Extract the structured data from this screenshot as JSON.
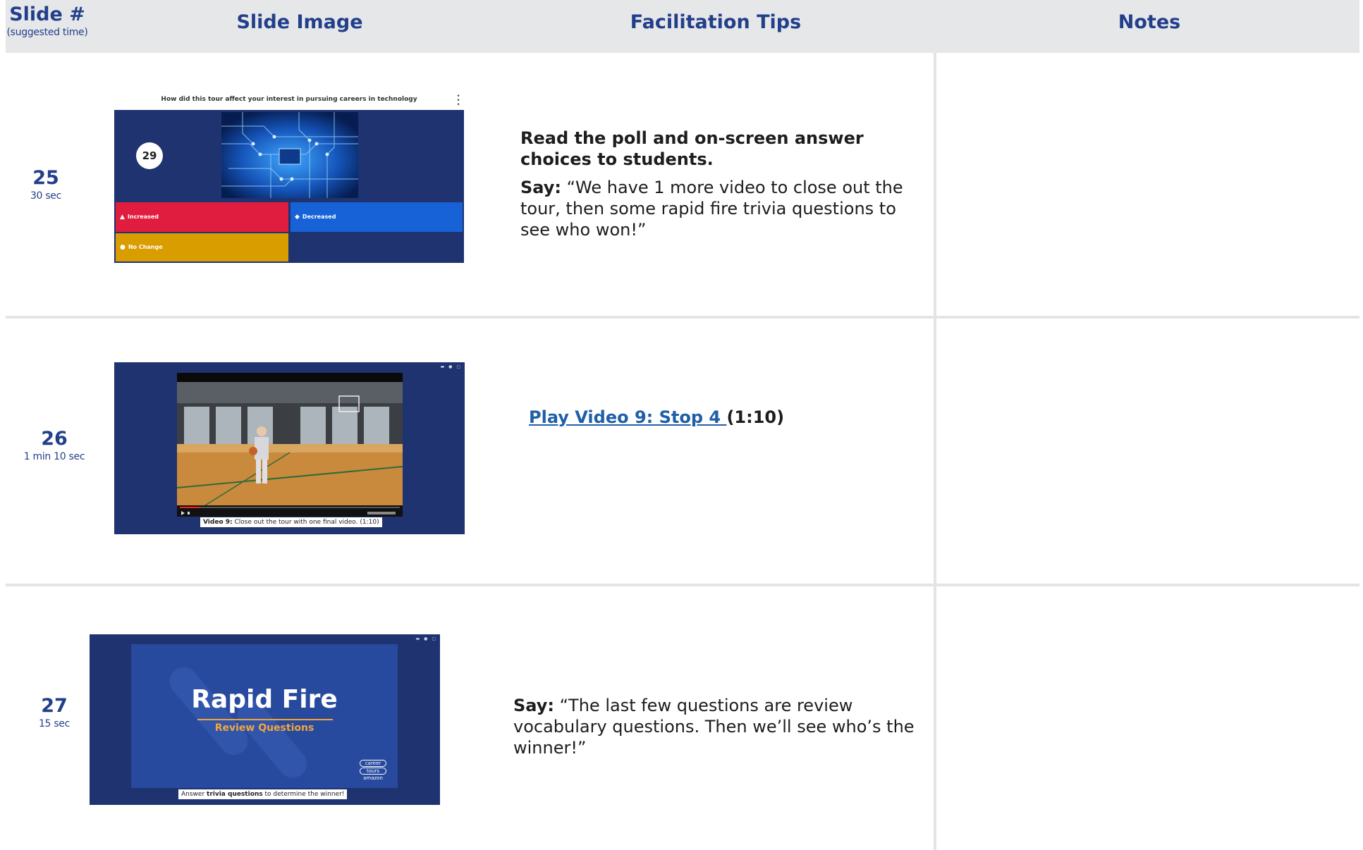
{
  "header": {
    "slide_col": "Slide #",
    "slide_col_sub": "(suggested time)",
    "image_col": "Slide Image",
    "tips_col": "Facilitation Tips",
    "notes_col": "Notes"
  },
  "rows": [
    {
      "number": "25",
      "time": "30 sec",
      "thumbnail": {
        "question": "How did this tour affect your interest in pursuing careers in technology",
        "timer": "29",
        "answers": [
          "Increased",
          "Decreased",
          "No Change"
        ],
        "colors": [
          "#e11d3f",
          "#1662d6",
          "#d99d00"
        ]
      },
      "tips_bold": "Read the poll and on-screen answer choices to students.",
      "tips_say_label": "Say:",
      "tips_say_text": " “We have 1 more video to close out the tour, then some rapid fire trivia questions to see who won!”"
    },
    {
      "number": "26",
      "time": "1 min 10 sec",
      "thumbnail": {
        "caption_bold": "Video 9:",
        "caption_text": " Close out the tour with one final video. (1:10)"
      },
      "link_text": "Play Video 9: Stop 4 ",
      "link_suffix": "(1:10)"
    },
    {
      "number": "27",
      "time": "15 sec",
      "thumbnail": {
        "title": "Rapid Fire",
        "subtitle": "Review Questions",
        "logo_line1": "career",
        "logo_line2": "tours",
        "logo_line3": "amazon",
        "caption_pre": "Answer ",
        "caption_bold": "trivia questions",
        "caption_post": " to determine the winner!"
      },
      "tips_say_label": "Say:",
      "tips_say_text": " “The last few questions are review vocabulary questions. Then we’ll see who’s the winner!”"
    }
  ]
}
